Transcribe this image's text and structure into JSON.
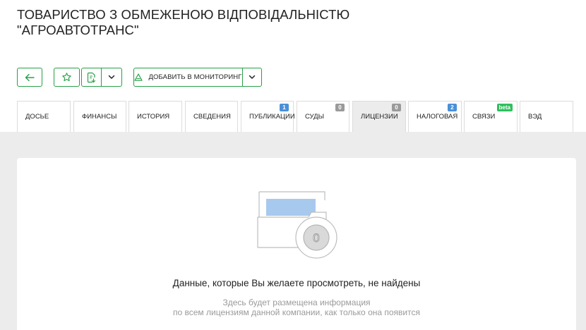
{
  "company": {
    "title_line1": "ТОВАРИСТВО З ОБМЕЖЕНОЮ ВІДПОВІДАЛЬНІСТЮ",
    "title_line2": "\"АГРОАВТОТРАНС\""
  },
  "toolbar": {
    "monitoring_label": "ДОБАВИТЬ В МОНИТОРИНГ"
  },
  "tabs": [
    {
      "label": "ДОСЬЕ",
      "badge": ""
    },
    {
      "label": "ФИНАНСЫ",
      "badge": ""
    },
    {
      "label": "ИСТОРИЯ",
      "badge": ""
    },
    {
      "label": "СВЕДЕНИЯ",
      "badge": ""
    },
    {
      "label": "ПУБЛИКАЦИИ",
      "badge": "1"
    },
    {
      "label": "СУДЫ",
      "badge": "0"
    },
    {
      "label": "ЛИЦЕНЗИИ",
      "badge": "0"
    },
    {
      "label": "НАЛОГОВАЯ",
      "badge": "2"
    },
    {
      "label": "СВЯЗИ",
      "badge": "beta"
    },
    {
      "label": "ВЭД",
      "badge": ""
    }
  ],
  "empty_state": {
    "illustration_number": "0",
    "title": "Данные, которые Вы желаете просмотреть, не найдены",
    "subtitle_line1": "Здесь будет размещена информация",
    "subtitle_line2": "по всем лицензиям данной компании, как только она появится"
  },
  "colors": {
    "accent": "#27a048",
    "badge_blue": "#4a90d9",
    "badge_gray": "#9a9a9a",
    "badge_green": "#2ebf5e",
    "content_bg": "#ececec"
  }
}
